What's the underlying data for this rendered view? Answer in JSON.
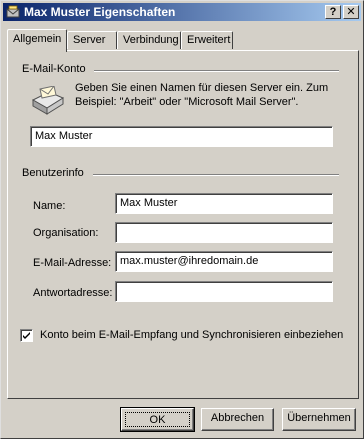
{
  "window": {
    "title": "Max Muster Eigenschaften"
  },
  "titlebar_buttons": {
    "help": "?",
    "close": "✕"
  },
  "tabs": [
    {
      "label": "Allgemein",
      "active": true
    },
    {
      "label": "Server",
      "active": false
    },
    {
      "label": "Verbindung",
      "active": false
    },
    {
      "label": "Erweitert",
      "active": false
    }
  ],
  "email_account": {
    "group_label": "E-Mail-Konto",
    "description": "Geben Sie einen Namen für diesen Server ein. Zum Beispiel: \"Arbeit\" oder \"Microsoft Mail Server\".",
    "account_name": "Max Muster",
    "icon": "mail-server-icon"
  },
  "user_info": {
    "group_label": "Benutzerinfo",
    "name_label": "Name:",
    "name_value": "Max Muster",
    "organization_label": "Organisation:",
    "organization_value": "",
    "email_label": "E-Mail-Adresse:",
    "email_value": "max.muster@ihredomain.de",
    "reply_label": "Antwortadresse:",
    "reply_value": ""
  },
  "sync_checkbox": {
    "label": "Konto beim E-Mail-Empfang und Synchronisieren einbeziehen",
    "checked": true
  },
  "buttons": {
    "ok": "OK",
    "cancel": "Abbrechen",
    "apply": "Übernehmen"
  },
  "colors": {
    "titlebar_start": "#0a246a",
    "titlebar_end": "#a6caf0",
    "face": "#d4d0c8"
  }
}
